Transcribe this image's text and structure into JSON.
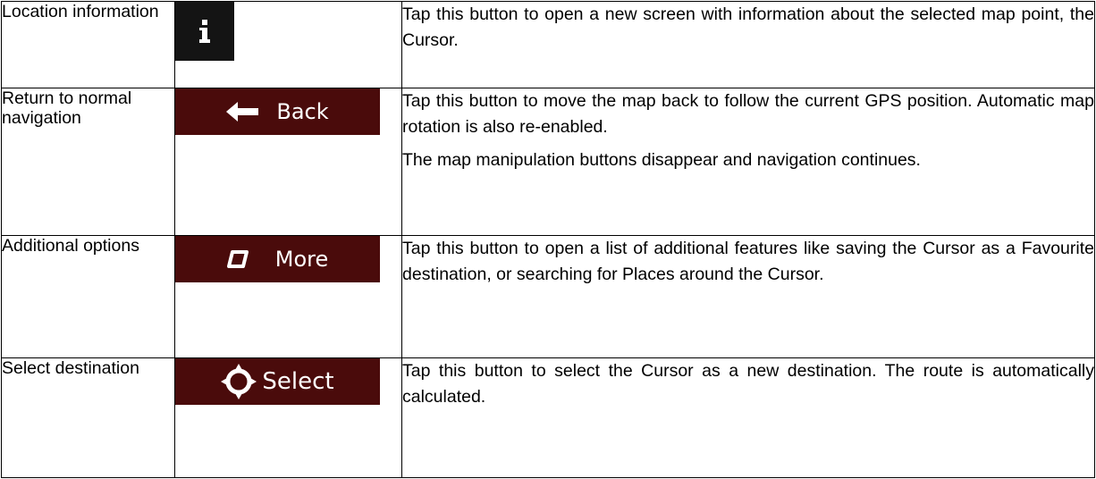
{
  "colors": {
    "button_bg": "#4a0b0b",
    "info_button_bg": "#141414",
    "icon": "#ffffff",
    "border": "#000000"
  },
  "rows": [
    {
      "function": "Location information",
      "button": {
        "type": "icon",
        "icon": "info-icon",
        "label": ""
      },
      "description": [
        "Tap this button to open a new screen with information about the selected map point, the Cursor."
      ]
    },
    {
      "function": "Return to normal navigation",
      "button": {
        "type": "labelled",
        "icon": "back-arrow-icon",
        "label": "Back"
      },
      "description": [
        "Tap this button to move the map back to follow the current GPS position. Automatic map rotation is also re-enabled.",
        "The map manipulation buttons disappear and navigation continues."
      ]
    },
    {
      "function": "Additional options",
      "button": {
        "type": "labelled",
        "icon": "more-icon",
        "label": "More"
      },
      "description": [
        "Tap this button to open a list of additional features like saving the Cursor as a Favourite destination, or searching for Places around the Cursor."
      ]
    },
    {
      "function": "Select destination",
      "button": {
        "type": "labelled",
        "icon": "crosshair-icon",
        "label": "Select"
      },
      "description": [
        "Tap this button to select the Cursor as a new destination. The route is automatically calculated."
      ]
    }
  ]
}
